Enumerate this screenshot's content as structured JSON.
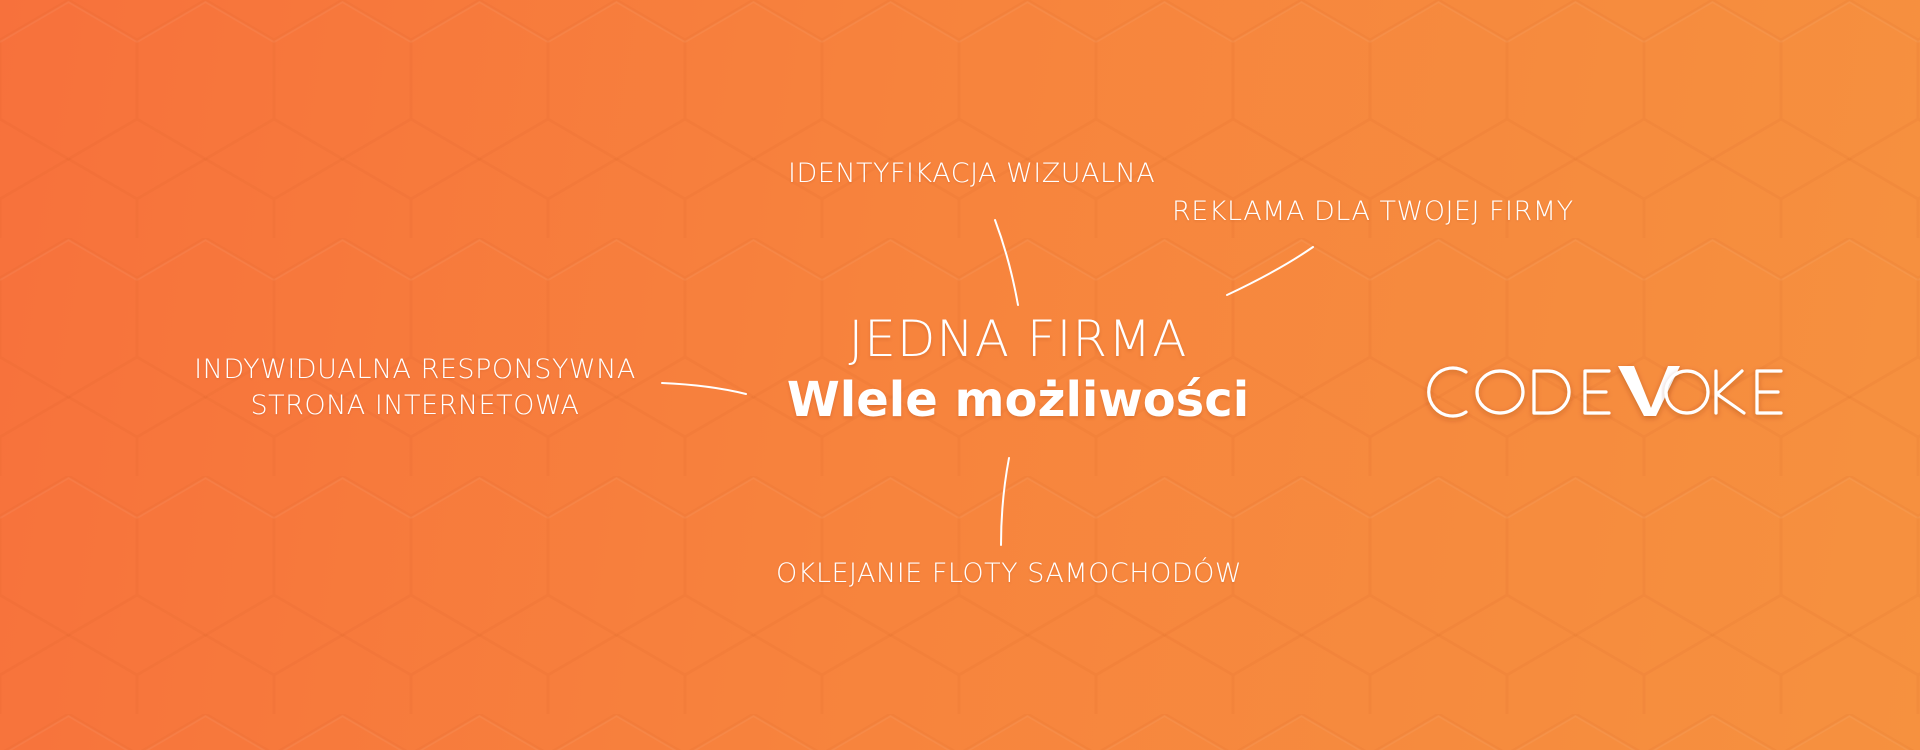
{
  "colors": {
    "gradient_start": "#f7713c",
    "gradient_end": "#f6913f",
    "text": "#ffffff"
  },
  "headline": {
    "line1": "JEDNA FIRMA",
    "line2": "Wlele możliwości"
  },
  "services": {
    "identyfikacja": "IDENTYFIKACJA WIZUALNA",
    "reklama": "REKLAMA DLA TWOJEJ FIRMY",
    "strona_line1": "INDYWIDUALNA RESPONSYWNA",
    "strona_line2": "STRONA INTERNETOWA",
    "oklejanie": "OKLEJANIE FLOTY SAMOCHODÓW"
  },
  "logo": {
    "text": "CODEVOKE"
  }
}
